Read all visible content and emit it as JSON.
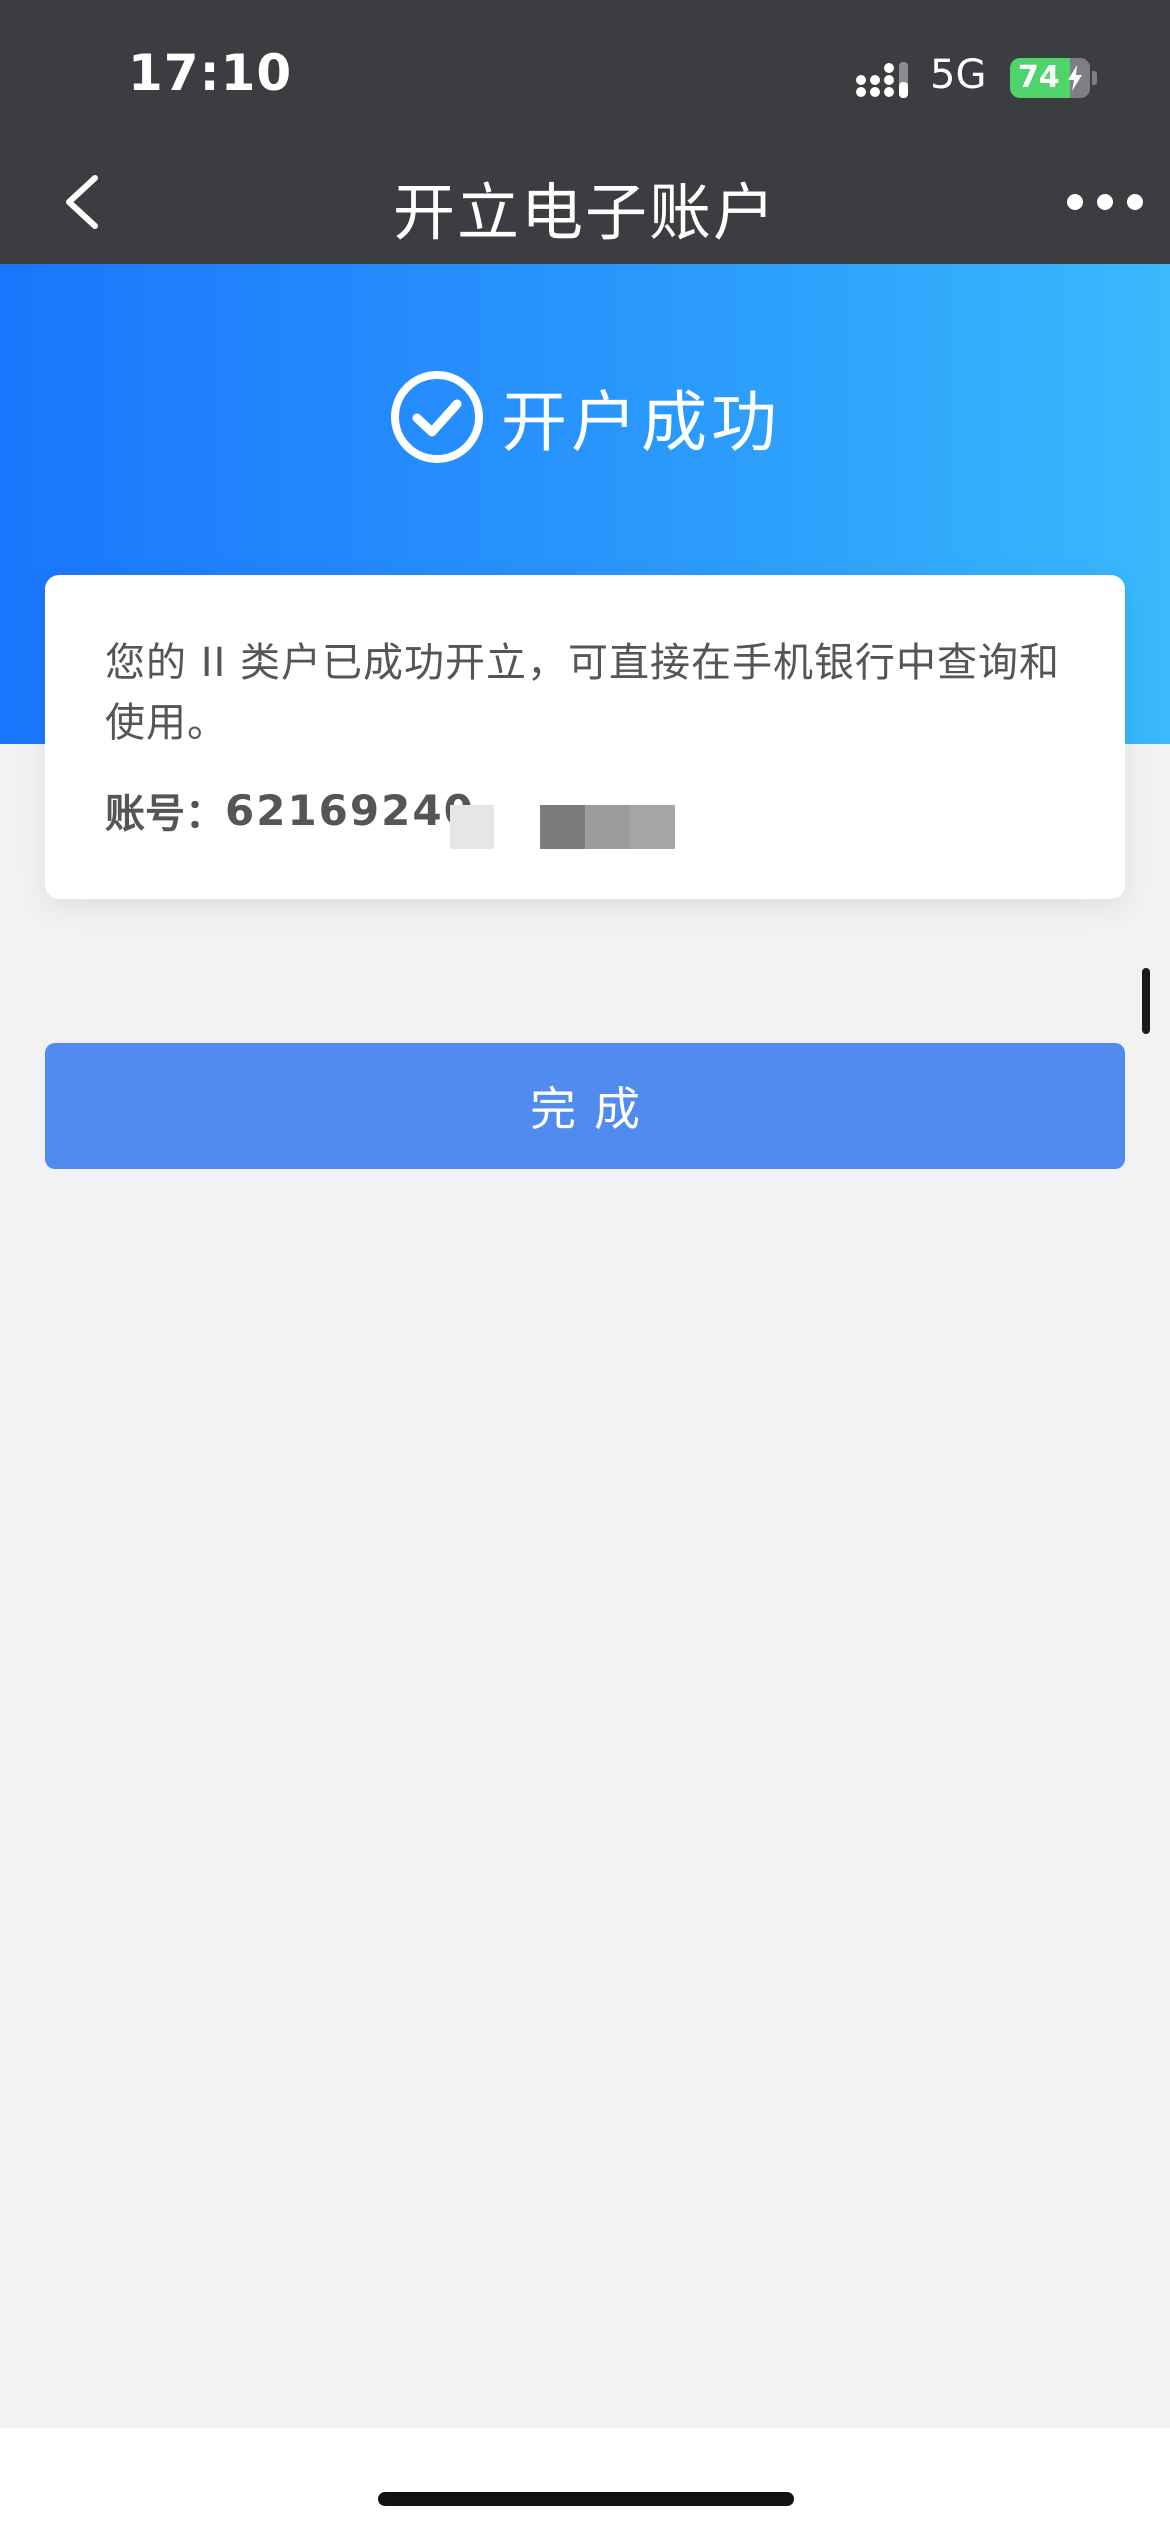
{
  "status_bar": {
    "time": "17:10",
    "network": "5G",
    "battery": "74"
  },
  "nav": {
    "title": "开立电子账户"
  },
  "hero": {
    "success_text": "开户成功"
  },
  "card": {
    "message": "您的 II 类户已成功开立，可直接在手机银行中查询和使用。",
    "account_label": "账号：",
    "account_number_visible": "62169240"
  },
  "actions": {
    "done_label": "完成"
  },
  "colors": {
    "nav_bg": "#3c3d41",
    "hero_start": "#1a76fc",
    "hero_end": "#3ab9fd",
    "button": "#528bf0",
    "battery": "#4fd46b"
  }
}
